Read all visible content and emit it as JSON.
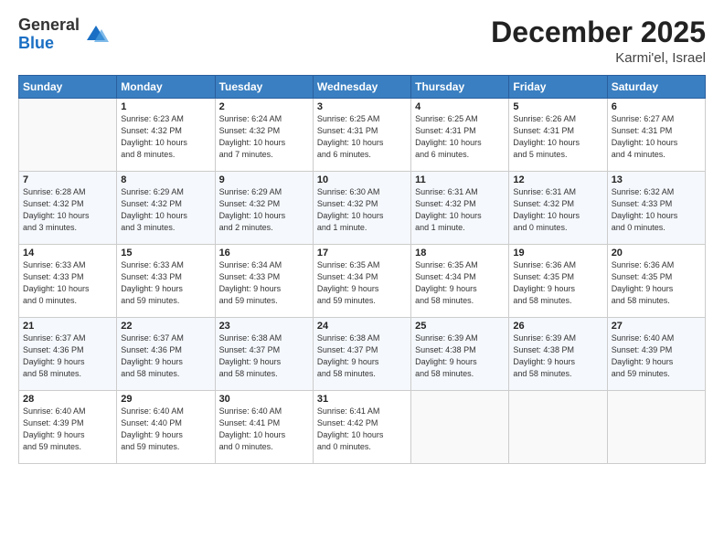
{
  "header": {
    "logo_general": "General",
    "logo_blue": "Blue",
    "month_title": "December 2025",
    "location": "Karmi'el, Israel"
  },
  "days_of_week": [
    "Sunday",
    "Monday",
    "Tuesday",
    "Wednesday",
    "Thursday",
    "Friday",
    "Saturday"
  ],
  "weeks": [
    [
      {
        "day": "",
        "info": ""
      },
      {
        "day": "1",
        "info": "Sunrise: 6:23 AM\nSunset: 4:32 PM\nDaylight: 10 hours\nand 8 minutes."
      },
      {
        "day": "2",
        "info": "Sunrise: 6:24 AM\nSunset: 4:32 PM\nDaylight: 10 hours\nand 7 minutes."
      },
      {
        "day": "3",
        "info": "Sunrise: 6:25 AM\nSunset: 4:31 PM\nDaylight: 10 hours\nand 6 minutes."
      },
      {
        "day": "4",
        "info": "Sunrise: 6:25 AM\nSunset: 4:31 PM\nDaylight: 10 hours\nand 6 minutes."
      },
      {
        "day": "5",
        "info": "Sunrise: 6:26 AM\nSunset: 4:31 PM\nDaylight: 10 hours\nand 5 minutes."
      },
      {
        "day": "6",
        "info": "Sunrise: 6:27 AM\nSunset: 4:31 PM\nDaylight: 10 hours\nand 4 minutes."
      }
    ],
    [
      {
        "day": "7",
        "info": "Sunrise: 6:28 AM\nSunset: 4:32 PM\nDaylight: 10 hours\nand 3 minutes."
      },
      {
        "day": "8",
        "info": "Sunrise: 6:29 AM\nSunset: 4:32 PM\nDaylight: 10 hours\nand 3 minutes."
      },
      {
        "day": "9",
        "info": "Sunrise: 6:29 AM\nSunset: 4:32 PM\nDaylight: 10 hours\nand 2 minutes."
      },
      {
        "day": "10",
        "info": "Sunrise: 6:30 AM\nSunset: 4:32 PM\nDaylight: 10 hours\nand 1 minute."
      },
      {
        "day": "11",
        "info": "Sunrise: 6:31 AM\nSunset: 4:32 PM\nDaylight: 10 hours\nand 1 minute."
      },
      {
        "day": "12",
        "info": "Sunrise: 6:31 AM\nSunset: 4:32 PM\nDaylight: 10 hours\nand 0 minutes."
      },
      {
        "day": "13",
        "info": "Sunrise: 6:32 AM\nSunset: 4:33 PM\nDaylight: 10 hours\nand 0 minutes."
      }
    ],
    [
      {
        "day": "14",
        "info": "Sunrise: 6:33 AM\nSunset: 4:33 PM\nDaylight: 10 hours\nand 0 minutes."
      },
      {
        "day": "15",
        "info": "Sunrise: 6:33 AM\nSunset: 4:33 PM\nDaylight: 9 hours\nand 59 minutes."
      },
      {
        "day": "16",
        "info": "Sunrise: 6:34 AM\nSunset: 4:33 PM\nDaylight: 9 hours\nand 59 minutes."
      },
      {
        "day": "17",
        "info": "Sunrise: 6:35 AM\nSunset: 4:34 PM\nDaylight: 9 hours\nand 59 minutes."
      },
      {
        "day": "18",
        "info": "Sunrise: 6:35 AM\nSunset: 4:34 PM\nDaylight: 9 hours\nand 58 minutes."
      },
      {
        "day": "19",
        "info": "Sunrise: 6:36 AM\nSunset: 4:35 PM\nDaylight: 9 hours\nand 58 minutes."
      },
      {
        "day": "20",
        "info": "Sunrise: 6:36 AM\nSunset: 4:35 PM\nDaylight: 9 hours\nand 58 minutes."
      }
    ],
    [
      {
        "day": "21",
        "info": "Sunrise: 6:37 AM\nSunset: 4:36 PM\nDaylight: 9 hours\nand 58 minutes."
      },
      {
        "day": "22",
        "info": "Sunrise: 6:37 AM\nSunset: 4:36 PM\nDaylight: 9 hours\nand 58 minutes."
      },
      {
        "day": "23",
        "info": "Sunrise: 6:38 AM\nSunset: 4:37 PM\nDaylight: 9 hours\nand 58 minutes."
      },
      {
        "day": "24",
        "info": "Sunrise: 6:38 AM\nSunset: 4:37 PM\nDaylight: 9 hours\nand 58 minutes."
      },
      {
        "day": "25",
        "info": "Sunrise: 6:39 AM\nSunset: 4:38 PM\nDaylight: 9 hours\nand 58 minutes."
      },
      {
        "day": "26",
        "info": "Sunrise: 6:39 AM\nSunset: 4:38 PM\nDaylight: 9 hours\nand 58 minutes."
      },
      {
        "day": "27",
        "info": "Sunrise: 6:40 AM\nSunset: 4:39 PM\nDaylight: 9 hours\nand 59 minutes."
      }
    ],
    [
      {
        "day": "28",
        "info": "Sunrise: 6:40 AM\nSunset: 4:39 PM\nDaylight: 9 hours\nand 59 minutes."
      },
      {
        "day": "29",
        "info": "Sunrise: 6:40 AM\nSunset: 4:40 PM\nDaylight: 9 hours\nand 59 minutes."
      },
      {
        "day": "30",
        "info": "Sunrise: 6:40 AM\nSunset: 4:41 PM\nDaylight: 10 hours\nand 0 minutes."
      },
      {
        "day": "31",
        "info": "Sunrise: 6:41 AM\nSunset: 4:42 PM\nDaylight: 10 hours\nand 0 minutes."
      },
      {
        "day": "",
        "info": ""
      },
      {
        "day": "",
        "info": ""
      },
      {
        "day": "",
        "info": ""
      }
    ]
  ]
}
